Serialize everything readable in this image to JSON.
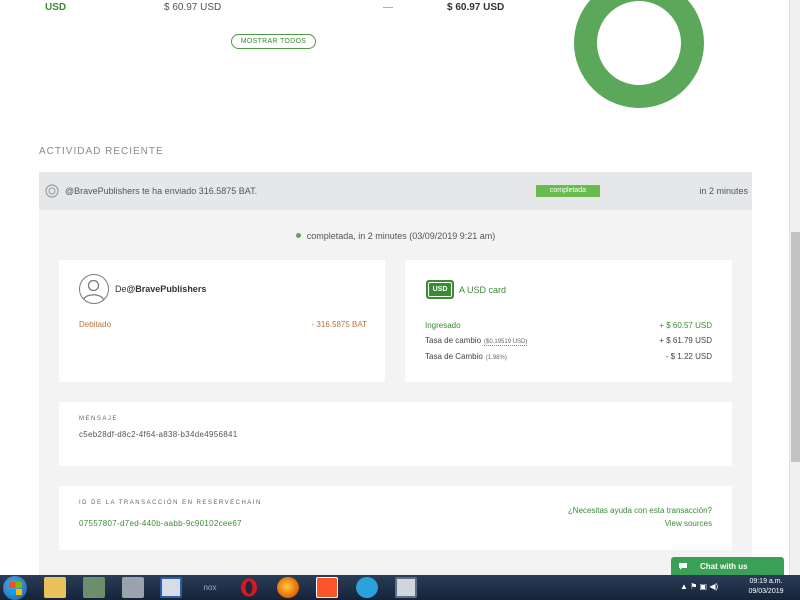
{
  "summary": {
    "currency": "USD",
    "amount": "$ 60.97 USD",
    "dash": "—",
    "total": "$ 60.97 USD",
    "show_all": "MOSTRAR TODOS"
  },
  "colors": {
    "accent": "#3a8c34",
    "donut": "#5ba85a",
    "badge": "#69bb4f",
    "debit": "#c0703a",
    "chat": "#3aa055"
  },
  "activity": {
    "section_title": "ACTIVIDAD RECIENTE",
    "header_text": "@BravePublishers te ha enviado 316.5875 BAT.",
    "badge": "completada",
    "time": "in 2 minutes",
    "status": "completada, in 2 minutes (03/09/2019 9:21 am)"
  },
  "from_card": {
    "prefix": "De",
    "name": "@BravePublishers",
    "debit_label": "Debitado",
    "debit_value": "- 316.5875 BAT"
  },
  "to_card": {
    "badge": "USD",
    "label": "A USD card",
    "rows": [
      {
        "label": "Ingresado",
        "sub": "",
        "value": "+ $ 60.57 USD"
      },
      {
        "label": "Tasa de cambio",
        "sub": "($0.19519 USD)",
        "value": "+ $ 61.79 USD"
      },
      {
        "label": "Tasa de Cambio",
        "sub": "(1.98%)",
        "value": "- $ 1.22 USD"
      }
    ]
  },
  "message": {
    "label": "MENSAJE",
    "value": "c5eb28df-d8c2-4f64-a838-b34de4956841"
  },
  "transaction": {
    "label": "ID DE LA TRANSACCIÓN EN RESERVECHAIN",
    "value": "07557807-d7ed-440b-aabb-9c90102cee67",
    "help": "¿Necesitas ayuda con esta transacción?",
    "sources": "View sources"
  },
  "chat": {
    "label": "Chat with us"
  },
  "taskbar": {
    "icons": [
      "windows-start",
      "file-explorer",
      "network-app",
      "snipping-tool",
      "code-app",
      "nox-app",
      "opera",
      "firefox",
      "brave",
      "telegram",
      "calculator"
    ],
    "nox_label": "nox",
    "tray": "▲ ⚑ ▣ ◀)",
    "time": "09:19 a.m.",
    "date": "09/03/2019"
  }
}
